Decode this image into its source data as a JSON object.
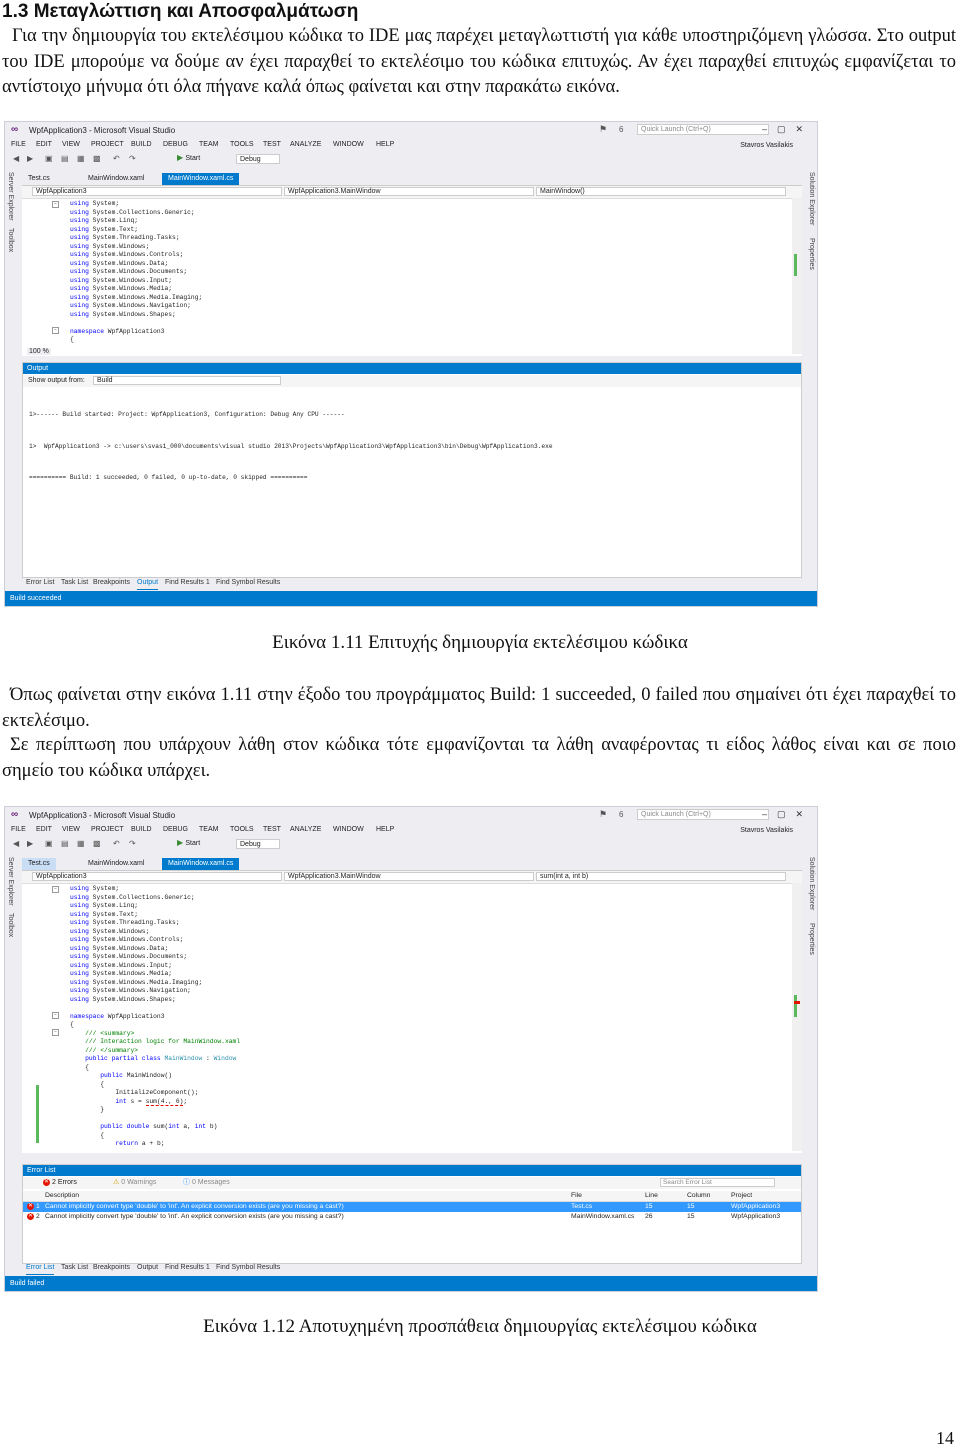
{
  "heading": "1.3 Μεταγλώττιση και Αποσφαλμάτωση",
  "para1": "Για την δημιουργία του εκτελέσιμου κώδικα το IDE μας παρέχει μεταγλωττιστή για κάθε υποστηριζόμενη γλώσσα. Στο output του IDE μπορούμε να δούμε αν έχει παραχθεί το εκτελέσιμο του κώδικα επιτυχώς. Αν έχει παραχθεί επιτυχώς εμφανίζεται το αντίστοιχο μήνυμα ότι όλα πήγανε καλά όπως φαίνεται και στην παρακάτω εικόνα.",
  "caption1": "Εικόνα 1.11 Επιτυχής δημιουργία εκτελέσιμου κώδικα",
  "para2": "Όπως φαίνεται στην εικόνα 1.11 στην έξοδο του προγράμματος Build: 1 succeeded, 0 failed που σημαίνει ότι έχει παραχθεί το εκτελέσιμο.",
  "para3": "Σε περίπτωση που υπάρχουν λάθη στον κώδικα τότε εμφανίζονται τα λάθη αναφέροντας τι είδος λάθος είναι και σε ποιο σημείο του κώδικα υπάρχει.",
  "caption2": "Εικόνα 1.12 Αποτυχημένη προσπάθεια δημιουργίας εκτελέσιμου κώδικα",
  "page_number": "14",
  "vs": {
    "title": "WpfApplication3 - Microsoft Visual Studio",
    "notif_count": "6",
    "quick_launch_placeholder": "Quick Launch (Ctrl+Q)",
    "menu": [
      "FILE",
      "EDIT",
      "VIEW",
      "PROJECT",
      "BUILD",
      "DEBUG",
      "TEAM",
      "TOOLS",
      "TEST",
      "ANALYZE",
      "WINDOW",
      "HELP"
    ],
    "user": "Stavros Vasilakis",
    "start_label": "Start",
    "config": "Debug",
    "left_tabs": [
      "Server Explorer",
      "Toolbox"
    ],
    "right_tabs": [
      "Solution Explorer",
      "Properties"
    ],
    "zoom": "100 %",
    "status_colors": {
      "accent": "#007acc"
    }
  },
  "shot1": {
    "tabs": [
      "Test.cs",
      "MainWindow.xaml",
      "MainWindow.xaml.cs"
    ],
    "nav": [
      "WpfApplication3",
      "WpfApplication3.MainWindow",
      "MainWindow()"
    ],
    "output_title": "Output",
    "show_output_label": "Show output from:",
    "show_output_value": "Build",
    "output_lines": [
      "1>------ Build started: Project: WpfApplication3, Configuration: Debug Any CPU ------",
      "1>  WpfApplication3 -> c:\\users\\svas1_000\\documents\\visual studio 2013\\Projects\\WpfApplication3\\WpfApplication3\\bin\\Debug\\WpfApplication3.exe",
      "========== Build: 1 succeeded, 0 failed, 0 up-to-date, 0 skipped =========="
    ],
    "bottom_tabs": [
      "Error List",
      "Task List",
      "Breakpoints",
      "Output",
      "Find Results 1",
      "Find Symbol Results"
    ],
    "status": "Build succeeded"
  },
  "shot2": {
    "tabs": [
      "Test.cs",
      "MainWindow.xaml",
      "MainWindow.xaml.cs"
    ],
    "nav": [
      "WpfApplication3",
      "WpfApplication3.MainWindow",
      "sum(int a, int b)"
    ],
    "panel_title": "Error List",
    "filter_errors": "2 Errors",
    "filter_warnings": "0 Warnings",
    "filter_messages": "0 Messages",
    "search_placeholder": "Search Error List",
    "columns": [
      "Description",
      "File",
      "Line",
      "Column",
      "Project"
    ],
    "rows": [
      {
        "n": "1",
        "desc": "Cannot implicitly convert type 'double' to 'int'. An explicit conversion exists (are you missing a cast?)",
        "file": "Test.cs",
        "line": "15",
        "col": "15",
        "project": "WpfApplication3"
      },
      {
        "n": "2",
        "desc": "Cannot implicitly convert type 'double' to 'int'. An explicit conversion exists (are you missing a cast?)",
        "file": "MainWindow.xaml.cs",
        "line": "26",
        "col": "15",
        "project": "WpfApplication3"
      }
    ],
    "bottom_tabs": [
      "Error List",
      "Task List",
      "Breakpoints",
      "Output",
      "Find Results 1",
      "Find Symbol Results"
    ],
    "status": "Build failed"
  },
  "code_usings": [
    "System",
    "System.Collections.Generic",
    "System.Linq",
    "System.Text",
    "System.Threading.Tasks",
    "System.Windows",
    "System.Windows.Controls",
    "System.Windows.Data",
    "System.Windows.Documents",
    "System.Windows.Input",
    "System.Windows.Media",
    "System.Windows.Media.Imaging",
    "System.Windows.Navigation",
    "System.Windows.Shapes"
  ],
  "code_namespace": "WpfApplication3"
}
